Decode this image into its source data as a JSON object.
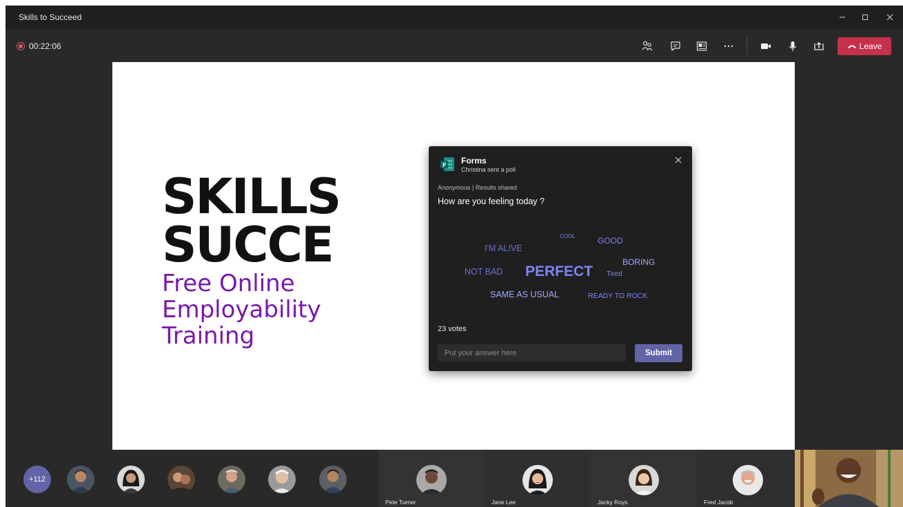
{
  "window": {
    "title": "Skills to Succeed",
    "controls": [
      "minimize",
      "maximize",
      "close"
    ]
  },
  "toolbar": {
    "recording_time": "00:22:06",
    "icons": [
      "participants-icon",
      "chat-icon",
      "whiteboard-icon",
      "more-options-icon",
      "camera-icon",
      "microphone-icon",
      "share-screen-icon"
    ],
    "leave_label": "Leave",
    "leave_color": "#c4314b"
  },
  "slide": {
    "headline_line1": "SKILLS",
    "headline_line2": "SUCCE",
    "sub_line1": "Free Online",
    "sub_line2": "Employability",
    "sub_line3": "Training",
    "accent_color": "#7719aa"
  },
  "poll": {
    "app_name": "Forms",
    "sender": "Christina sent a poll",
    "meta": "Anonymous | Results shared",
    "question": "How are you feeling today ?",
    "words": [
      "COOL",
      "GOOD",
      "I'M ALIVE",
      "BORING",
      "NOT BAD",
      "PERFECT",
      "Tired",
      "SAME AS USUAL",
      "READY TO ROCK"
    ],
    "votes": "23 votes",
    "input_placeholder": "Put your answer here",
    "submit_label": "Submit",
    "accent_color": "#6264a7"
  },
  "participants": {
    "overflow_count": "+112",
    "tiles": [
      {
        "name": "Pete Turner"
      },
      {
        "name": "Jane Lee"
      },
      {
        "name": "Jacky Roys"
      },
      {
        "name": "Fred Jacob"
      }
    ]
  }
}
